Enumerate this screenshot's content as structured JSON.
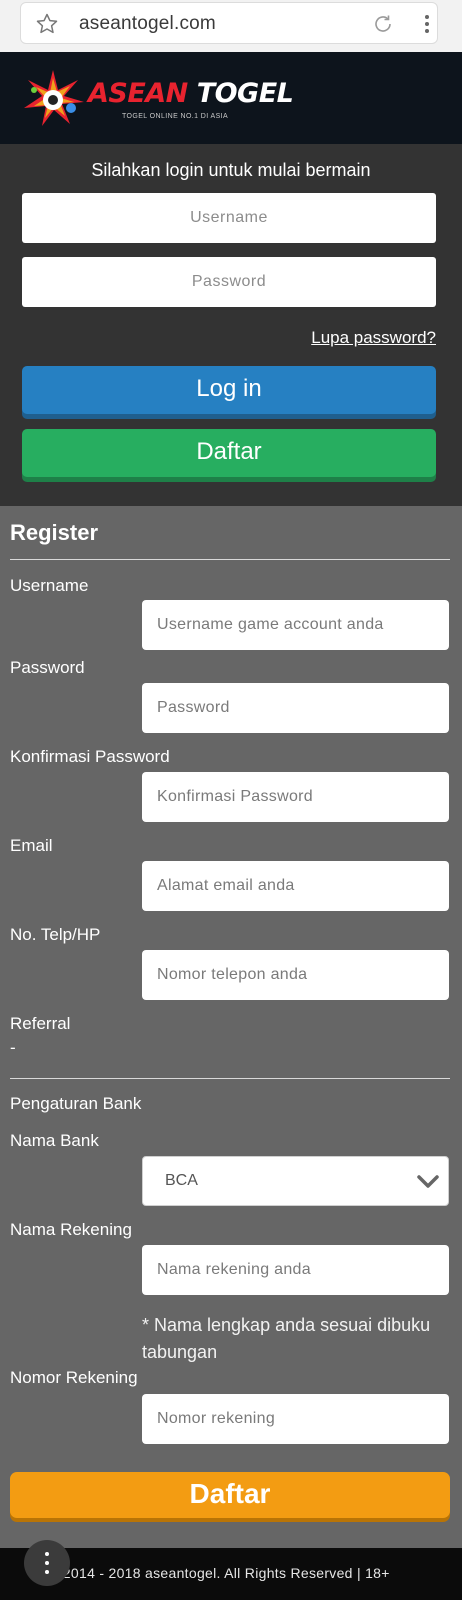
{
  "browser": {
    "url": "aseantogel.com",
    "star_icon": "star-outline-icon",
    "reload_icon": "reload-icon",
    "menu_icon": "kebab-menu-icon"
  },
  "logo": {
    "word1": "ASEAN",
    "word2": "TOGEL",
    "tagline": "TOGEL ONLINE NO.1 DI ASIA"
  },
  "login": {
    "title": "Silahkan login untuk mulai bermain",
    "username_placeholder": "Username",
    "password_placeholder": "Password",
    "forgot_link": "Lupa password?",
    "login_button": "Log in",
    "register_button": "Daftar",
    "colors": {
      "panel": "#333333",
      "login_btn": "#2680c2",
      "daftar_btn": "#27ae60"
    }
  },
  "register": {
    "title": "Register",
    "fields": {
      "username": {
        "label": "Username",
        "placeholder": "Username game account anda"
      },
      "password": {
        "label": "Password",
        "placeholder": "Password"
      },
      "confirm": {
        "label": "Konfirmasi Password",
        "placeholder": "Konfirmasi Password"
      },
      "email": {
        "label": "Email",
        "placeholder": "Alamat email anda"
      },
      "phone": {
        "label": "No. Telp/HP",
        "placeholder": "Nomor telepon anda"
      }
    },
    "referral": {
      "label": "Referral",
      "value": "-"
    },
    "bank_section": "Pengaturan Bank",
    "bank": {
      "label": "Nama Bank",
      "value": "BCA"
    },
    "account_name": {
      "label": "Nama Rekening",
      "placeholder": "Nama rekening anda",
      "note": "* Nama lengkap anda sesuai dibuku tabungan"
    },
    "account_number": {
      "label": "Nomor Rekening",
      "placeholder": "Nomor rekening"
    },
    "submit": "Daftar",
    "colors": {
      "submit_btn": "#f39c12"
    }
  },
  "footer": {
    "text": "© 2014 - 2018 aseantogel. All Rights Reserved | 18+"
  }
}
